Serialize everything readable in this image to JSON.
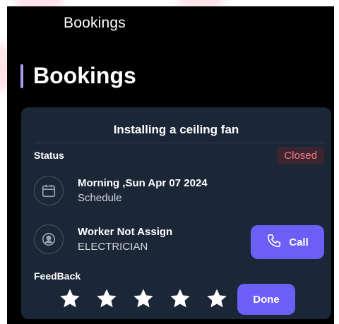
{
  "app_bar": {
    "title": "Bookings"
  },
  "page": {
    "title": "Bookings"
  },
  "booking": {
    "service_title": "Installing a ceiling fan",
    "status_label": "Status",
    "status_value": "Closed",
    "schedule": {
      "primary": "Morning ,Sun Apr 07 2024",
      "secondary": "Schedule",
      "icon": "calendar-icon"
    },
    "worker": {
      "primary": "Worker Not Assign",
      "secondary": "ELECTRICIAN",
      "icon": "user-icon"
    },
    "call_label": "Call",
    "feedback_label": "FeedBack",
    "rating_max": 5,
    "done_label": "Done"
  },
  "colors": {
    "background": "#000000",
    "card": "#1b2636",
    "accent": "#6b5ff6",
    "accent_bar": "#a99cf0",
    "status_closed_text": "#ff7b81",
    "status_closed_bg": "#3a2530"
  }
}
